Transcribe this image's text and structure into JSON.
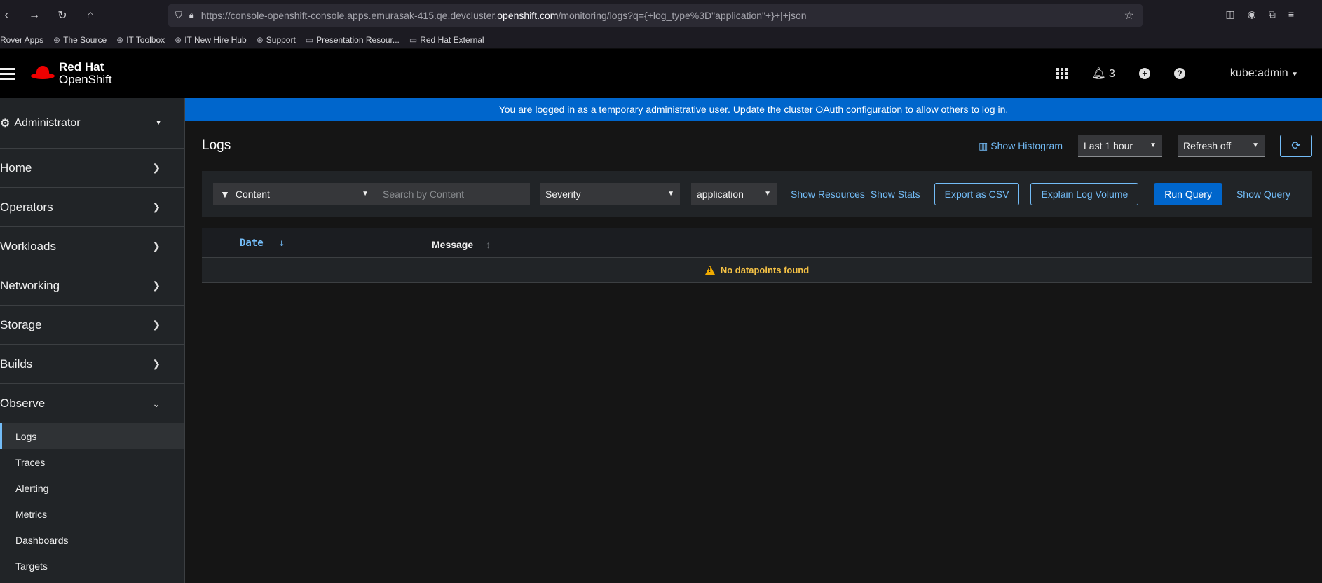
{
  "browser": {
    "url_prefix": "https://console-openshift-console.apps.emurasak-415.qe.devcluster.",
    "url_domain": "openshift.com",
    "url_suffix": "/monitoring/logs?q={+log_type%3D\"application\"+}+|+json",
    "bookmarks": [
      "Rover Apps",
      "The Source",
      "IT Toolbox",
      "IT New Hire Hub",
      "Support",
      "Presentation Resour...",
      "Red Hat External"
    ]
  },
  "masthead": {
    "brand_line1": "Red Hat",
    "brand_line2": "OpenShift",
    "notification_count": "3",
    "user": "kube:admin"
  },
  "sidebar": {
    "perspective": "Administrator",
    "items": [
      "Home",
      "Operators",
      "Workloads",
      "Networking",
      "Storage",
      "Builds"
    ],
    "expanded": "Observe",
    "sub_items": [
      "Logs",
      "Traces",
      "Alerting",
      "Metrics",
      "Dashboards",
      "Targets"
    ],
    "active_sub": "Logs"
  },
  "banner": {
    "before": "You are logged in as a temporary administrative user. Update the",
    "link": "cluster OAuth configuration",
    "after": "to allow others to log in."
  },
  "page": {
    "title": "Logs",
    "show_histogram": "Show Histogram",
    "time_range": "Last 1 hour",
    "refresh": "Refresh off"
  },
  "toolbar": {
    "filter_attr": "Content",
    "search_placeholder": "Search by Content",
    "severity": "Severity",
    "log_type": "application",
    "show_resources": "Show Resources",
    "show_stats": "Show Stats",
    "export_csv": "Export as CSV",
    "explain_volume": "Explain Log Volume",
    "run_query": "Run Query",
    "show_query": "Show Query"
  },
  "table": {
    "col_date": "Date",
    "col_message": "Message",
    "empty": "No datapoints found"
  },
  "colors": {
    "accent": "#73bcf7",
    "primary": "#0066cc",
    "warning": "#f0ab00",
    "brand_red": "#ee0000"
  }
}
